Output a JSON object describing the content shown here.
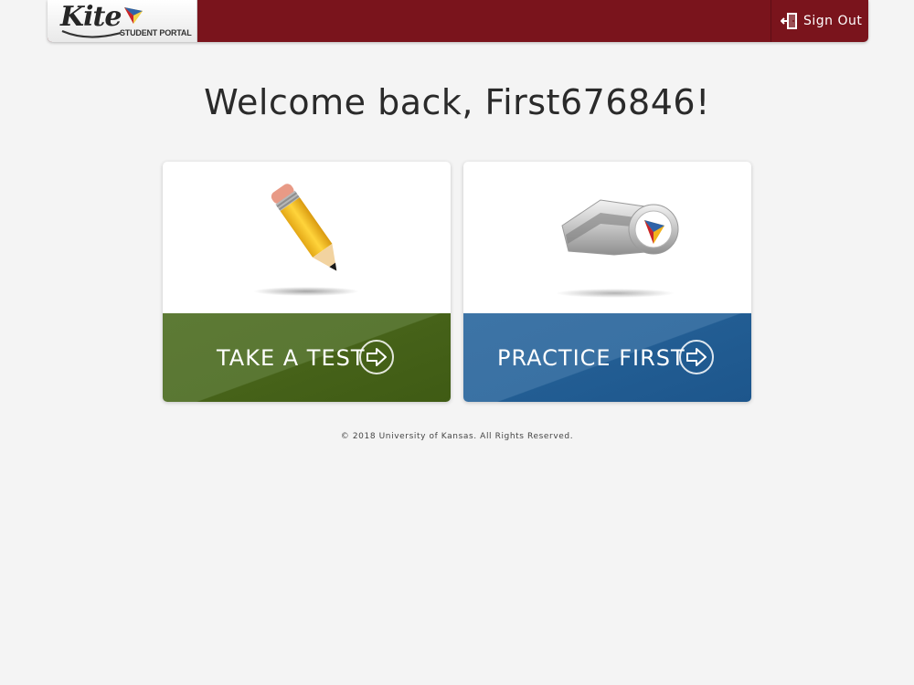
{
  "header": {
    "logo_word": "Kite",
    "logo_subtitle": "STUDENT PORTAL",
    "signout_label": "Sign Out",
    "signout_icon": "door-exit-icon",
    "brand_color": "#7a141c"
  },
  "welcome": {
    "text": "Welcome back, First676846!"
  },
  "cards": [
    {
      "label": "TAKE A TEST",
      "icon": "pencil-icon",
      "arrow_icon": "arrow-right-circle-icon",
      "color": "#4f6c22"
    },
    {
      "label": "PRACTICE FIRST",
      "icon": "whistle-icon",
      "arrow_icon": "arrow-right-circle-icon",
      "color": "#2a6499"
    }
  ],
  "footer": {
    "text": "© 2018 University of Kansas. All Rights Reserved."
  }
}
